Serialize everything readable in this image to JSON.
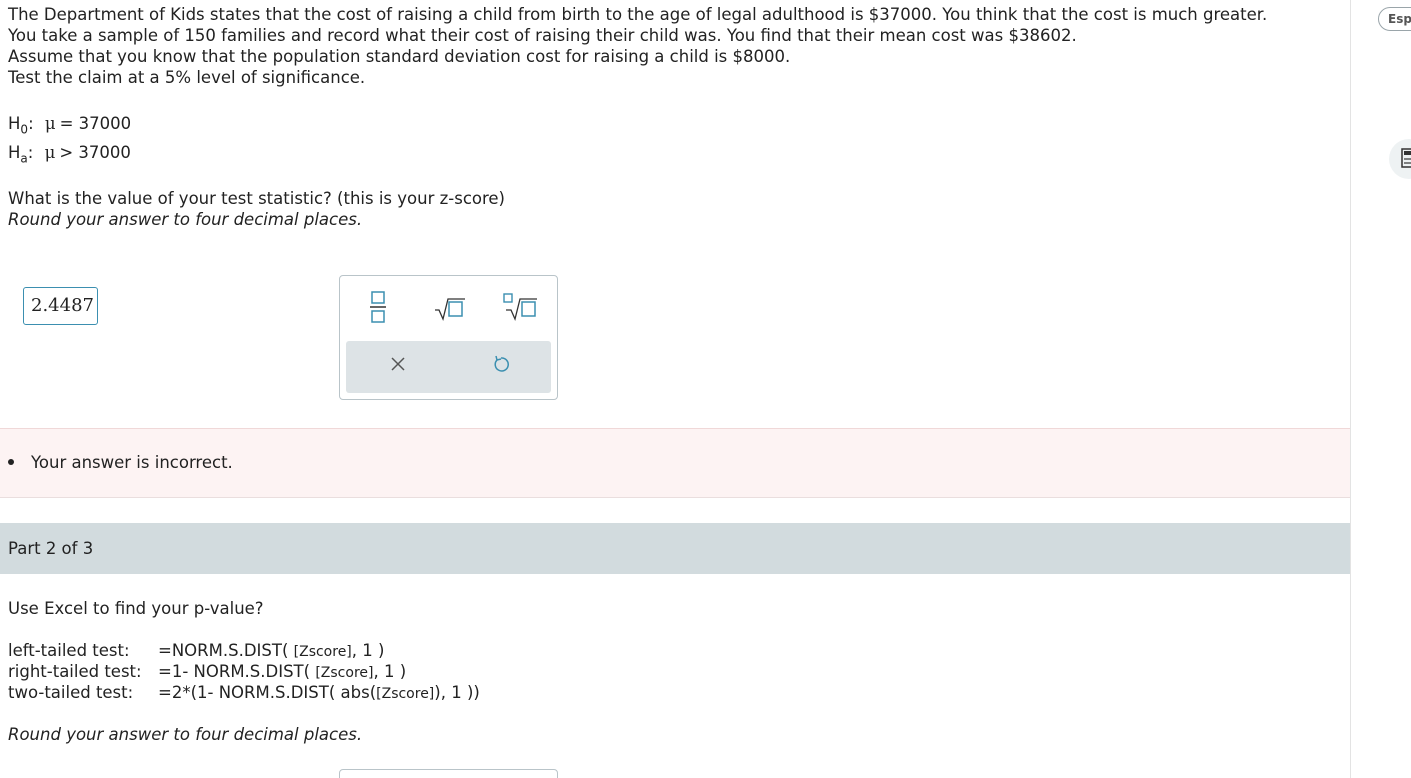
{
  "problem": {
    "lines": [
      "The Department of Kids states that the cost of raising a child from birth to the age of legal adulthood is $37000.  You think that the cost is much greater.",
      "You take a sample of 150 families and record what their cost of raising their child was.  You find that their mean cost was $38602.",
      "Assume that you know that the population standard deviation cost for raising a child is $8000.",
      "Test the claim at a 5% level of significance."
    ]
  },
  "hypotheses": {
    "h0": {
      "label": "H",
      "sub": "0",
      "colon": ":",
      "mu": "μ",
      "rel": "= 37000"
    },
    "ha": {
      "label": "H",
      "sub": "a",
      "colon": ":",
      "mu": "μ",
      "rel": "> 37000"
    }
  },
  "part1": {
    "question": "What is the value of your test statistic?  (this is your z-score)",
    "instruction": "Round your answer to four decimal places.",
    "answer_value": "2.4487",
    "feedback": "Your answer is incorrect."
  },
  "palette": {
    "tools": [
      "fraction-icon",
      "sqrt-icon",
      "nth-root-icon"
    ],
    "actions": [
      "clear-icon",
      "undo-icon"
    ]
  },
  "part2": {
    "header": "Part 2 of 3",
    "question": "Use Excel to find your p-value?",
    "formulas": [
      {
        "label": "left-tailed test:",
        "pre": "=NORM.S.DIST( ",
        "z": "[Zscore]",
        "post": ", 1 )"
      },
      {
        "label": "right-tailed test:",
        "pre": "=1- NORM.S.DIST( ",
        "z": "[Zscore]",
        "post": ", 1 )"
      },
      {
        "label": "two-tailed test:",
        "pre": "=2*(1- NORM.S.DIST( abs(",
        "z": "[Zscore]",
        "post": "), 1 ))"
      }
    ],
    "instruction": "Round your answer to four decimal places."
  },
  "sidebar": {
    "language_button": "Espa"
  },
  "colors": {
    "accent": "#3b8fb0",
    "feedback_bg": "#fdf3f3",
    "part_header_bg": "#d2dbde"
  }
}
